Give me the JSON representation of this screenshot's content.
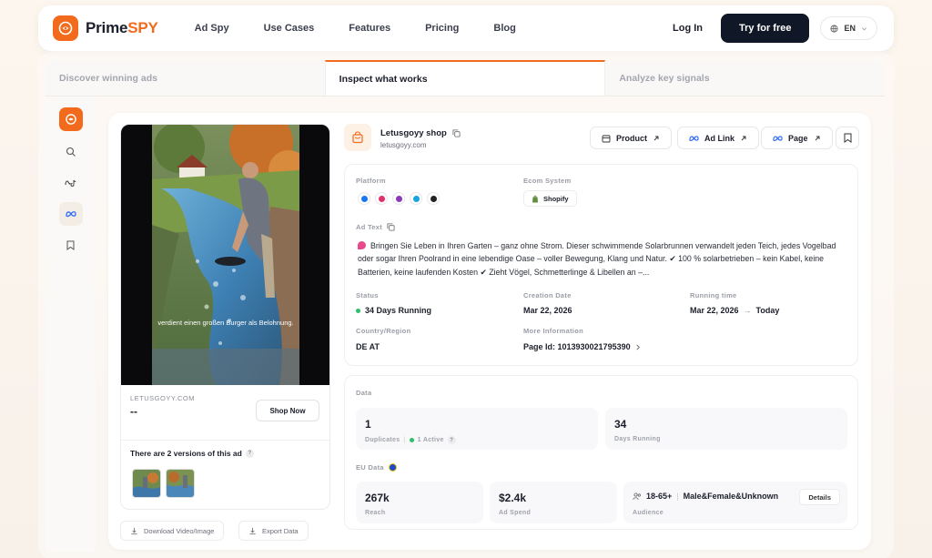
{
  "brand": {
    "name_part1": "Prime",
    "name_part2": "SPY",
    "accent_color": "#f26b1d"
  },
  "nav": {
    "links": [
      "Ad Spy",
      "Use Cases",
      "Features",
      "Pricing",
      "Blog"
    ],
    "login": "Log In",
    "cta": "Try for free",
    "language": "EN"
  },
  "tabs": [
    {
      "label": "Discover winning ads",
      "active": false
    },
    {
      "label": "Inspect what works",
      "active": true
    },
    {
      "label": "Analyze key signals",
      "active": false
    }
  ],
  "sidebar": {
    "icons": [
      "brand-logo-icon",
      "search-icon",
      "meta-tiktok-icon",
      "meta-icon",
      "bookmark-icon"
    ]
  },
  "media": {
    "caption": "verdient einen großen Burger als Belohnung.",
    "domain": "LETUSGOYY.COM",
    "title": "--",
    "shop_button": "Shop Now",
    "versions_text": "There are 2 versions of this ad",
    "help_mark": "?",
    "download_button": "Download Video/Image",
    "export_button": "Export Data"
  },
  "shop": {
    "name": "Letusgoyy shop",
    "domain": "letusgoyy.com",
    "product_button": "Product",
    "ad_link_button": "Ad Link",
    "page_button": "Page"
  },
  "info": {
    "platform_label": "Platform",
    "ecom_label": "Ecom System",
    "ecom_value": "Shopify",
    "ad_text_label": "Ad Text",
    "ad_text": "Bringen Sie Leben in Ihren Garten – ganz ohne Strom. Dieser schwimmende Solarbrunnen verwandelt jeden Teich, jedes Vogelbad oder sogar Ihren Poolrand in eine lebendige Oase – voller Bewegung, Klang und Natur. ✔ 100 % solarbetrieben – kein Kabel, keine Batterien, keine laufenden Kosten ✔ Zieht Vögel, Schmetterlinge & Libellen an –...",
    "status_label": "Status",
    "status_value": "34 Days Running",
    "creation_label": "Creation Date",
    "creation_value": "Mar 22, 2026",
    "running_label": "Running time",
    "running_start": "Mar 22, 2026",
    "running_arrow": "→",
    "running_end": "Today",
    "country_label": "Country/Region",
    "country_value": "DE AT",
    "more_label": "More Information",
    "page_id": "Page Id: 1013930021795390"
  },
  "data": {
    "section_label": "Data",
    "duplicates_value": "1",
    "duplicates_label": "Duplicates",
    "active_label": "1 Active",
    "days_value": "34",
    "days_label": "Days Running",
    "eu_label": "EU Data",
    "reach_value": "267k",
    "reach_label": "Reach",
    "spend_value": "$2.4k",
    "spend_label": "Ad Spend",
    "audience_age": "18-65+",
    "audience_gender": "Male&Female&Unknown",
    "audience_label": "Audience",
    "details_button": "Details"
  }
}
